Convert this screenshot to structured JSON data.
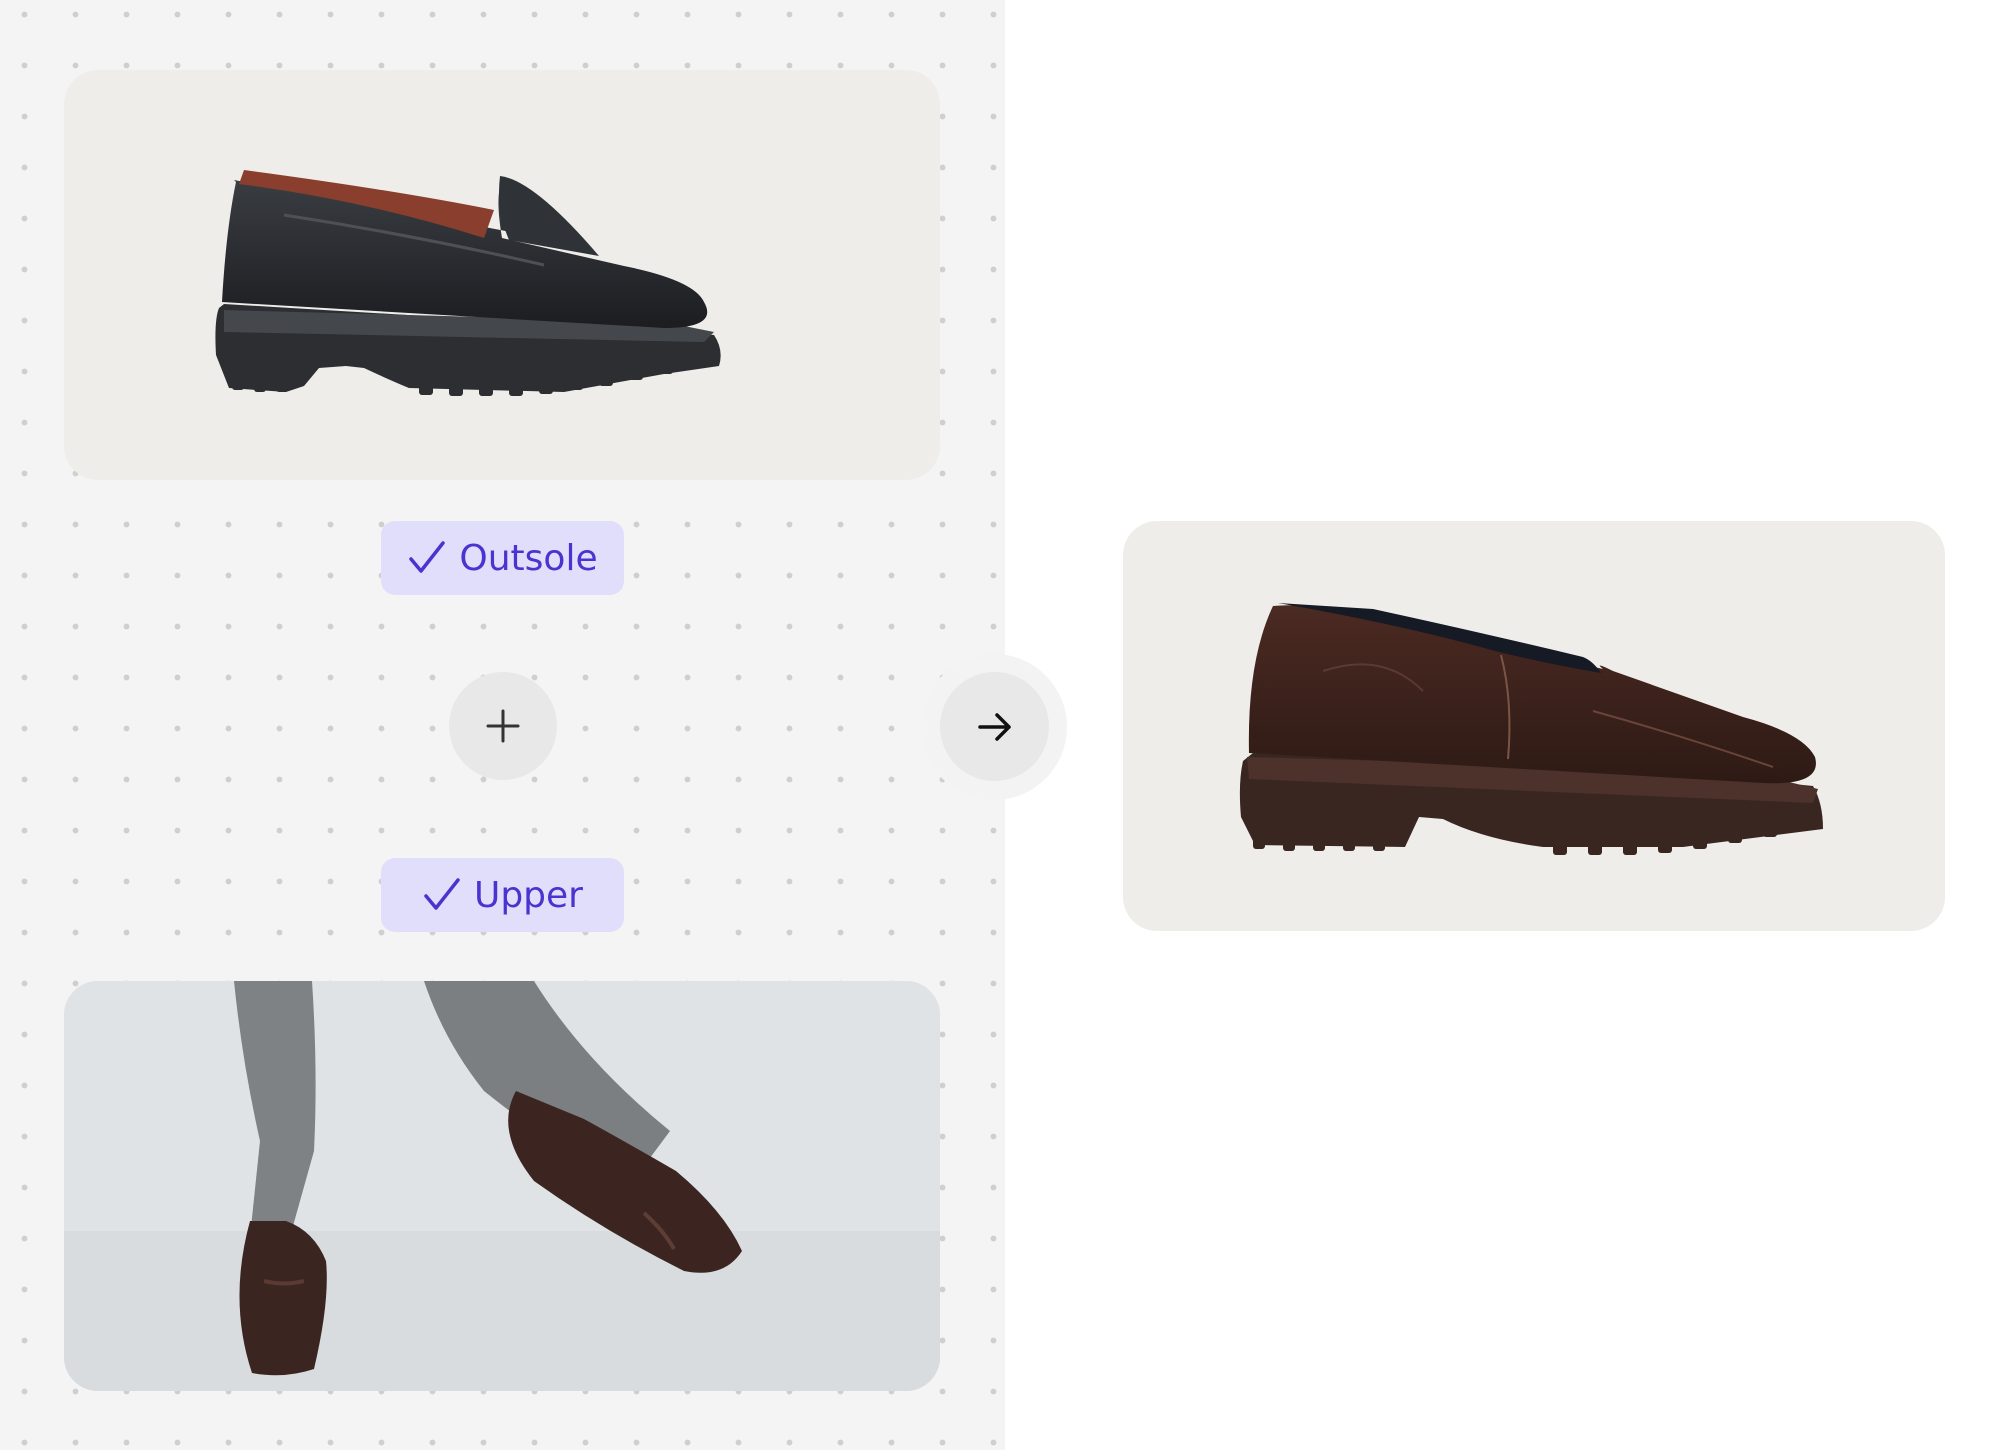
{
  "inputs": {
    "outsole_chip": {
      "label": "Outsole",
      "icon": "check-icon"
    },
    "upper_chip": {
      "label": "Upper",
      "icon": "check-icon"
    }
  },
  "actions": {
    "combine_icon": "plus-icon",
    "generate_icon": "arrow-right-icon"
  },
  "images": {
    "outsole_source": "black-loafer-photo",
    "upper_source": "brown-patent-shoes-photo",
    "result": "brown-patent-lug-sole-shoe-photo"
  },
  "colors": {
    "chip_background": "#e1defc",
    "chip_text": "#4a33cf",
    "card_background": "#eeede9",
    "canvas_background": "#f4f4f4"
  }
}
